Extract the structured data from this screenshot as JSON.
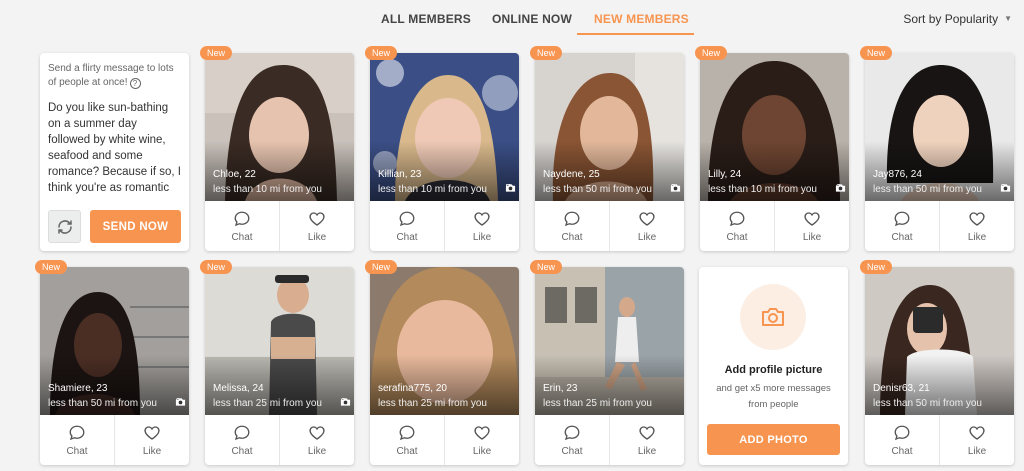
{
  "tabs": {
    "all": "ALL MEMBERS",
    "online": "ONLINE NOW",
    "new": "NEW MEMBERS",
    "active": "new"
  },
  "sort": {
    "label": "Sort by Popularity",
    "icon": "caret-down-icon"
  },
  "promo": {
    "hint": "Send a flirty message to lots of people at once!",
    "message": "Do you like sun-bathing on a summer day followed by white wine, seafood and some romance? Because if so, I think you're as romantic",
    "send_label": "SEND NOW"
  },
  "badge_label": "New",
  "action_labels": {
    "chat": "Chat",
    "like": "Like"
  },
  "members": [
    {
      "name": "Chloe",
      "age": ", 22",
      "distance": "less than 10 mi from you",
      "photos": ""
    },
    {
      "name": "Killian",
      "age": ", 23",
      "distance": "less than 10 mi from you",
      "photos": "5"
    },
    {
      "name": "Naydene",
      "age": ", 25",
      "distance": "less than 50 mi from you",
      "photos": "3"
    },
    {
      "name": "Lilly",
      "age": ", 24",
      "distance": "less than 10 mi from you",
      "photos": "6"
    },
    {
      "name": "Jay876",
      "age": ", 24",
      "distance": "less than 50 mi from you",
      "photos": "3"
    },
    {
      "name": "Shamiere",
      "age": ", 23",
      "distance": "less than 50 mi from you",
      "photos": "2"
    },
    {
      "name": "Melissa",
      "age": ", 24",
      "distance": "less than 25 mi from you",
      "photos": "2"
    },
    {
      "name": "serafina775",
      "age": ", 20",
      "distance": "less than 25 mi from you",
      "photos": ""
    },
    {
      "name": "Erin",
      "age": ", 23",
      "distance": "less than 25 mi from you",
      "photos": ""
    },
    {
      "name": "Denisr63",
      "age": ", 21",
      "distance": "less than 50 mi from you",
      "photos": ""
    }
  ],
  "add_photo": {
    "title": "Add profile picture",
    "subtitle": "and get x5 more messages from people",
    "button": "ADD PHOTO"
  },
  "colors": {
    "accent": "#f79450",
    "background": "#f3f3f3"
  }
}
